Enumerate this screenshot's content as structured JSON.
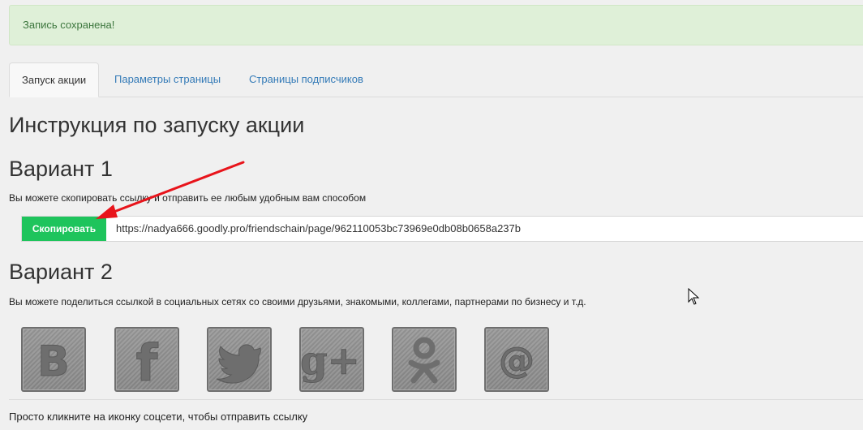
{
  "alert": {
    "message": "Запись сохранена!"
  },
  "tabs": [
    {
      "label": "Запуск акции",
      "active": true
    },
    {
      "label": "Параметры страницы",
      "active": false
    },
    {
      "label": "Страницы подписчиков",
      "active": false
    }
  ],
  "main": {
    "title": "Инструкция по запуску акции",
    "variant1": {
      "heading": "Вариант 1",
      "description": "Вы можете скопировать ссылку и отправить ее любым удобным вам способом",
      "copy_button": "Скопировать",
      "url": "https://nadya666.goodly.pro/friendschain/page/962110053bc73969e0db08b0658a237b"
    },
    "variant2": {
      "heading": "Вариант 2",
      "description": "Вы можете поделиться ссылкой в социальных сетях со своими друзьями, знакомыми, коллегами, партнерами по бизнесу и т.д.",
      "social_buttons": [
        {
          "icon": "vk-icon",
          "glyph": "B"
        },
        {
          "icon": "facebook-icon",
          "glyph": "f"
        },
        {
          "icon": "twitter-icon",
          "glyph": ""
        },
        {
          "icon": "google-plus-icon",
          "glyph": "g+"
        },
        {
          "icon": "odnoklassniki-icon",
          "glyph": ""
        },
        {
          "icon": "email-icon",
          "glyph": "@"
        }
      ]
    },
    "footer_note": "Просто кликните на иконку соцсети, чтобы отправить ссылку"
  },
  "colors": {
    "alert_bg": "#dff0d8",
    "alert_text": "#3c763d",
    "link": "#337ab7",
    "copy_button": "#1ec45c",
    "annotation_arrow": "#e8141b"
  }
}
